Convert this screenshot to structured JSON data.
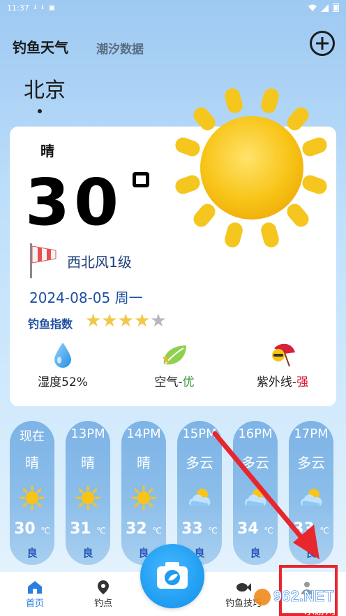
{
  "status_bar": {
    "time": "11:37"
  },
  "header": {
    "app_title": "钓鱼天气",
    "tide_link": "潮汐数据",
    "add_icon": "plus-circle-icon"
  },
  "location": {
    "city": "北京"
  },
  "today": {
    "condition": "晴",
    "temperature": "30",
    "wind": "西北风1级",
    "date": "2024-08-05 周一",
    "fishing_index_label": "钓鱼指数",
    "fishing_index_stars": 4,
    "fishing_index_max": 5
  },
  "metrics": {
    "humidity_label": "湿度52%",
    "air_label": "空气-",
    "air_value": "优",
    "uv_label": "紫外线-",
    "uv_value": "强"
  },
  "hourly": [
    {
      "time": "现在",
      "condition": "晴",
      "temp": "30",
      "unit": "℃",
      "aq": "良",
      "icon": "sun-icon"
    },
    {
      "time": "13PM",
      "condition": "晴",
      "temp": "31",
      "unit": "℃",
      "aq": "良",
      "icon": "sun-icon"
    },
    {
      "time": "14PM",
      "condition": "晴",
      "temp": "32",
      "unit": "℃",
      "aq": "良",
      "icon": "sun-icon"
    },
    {
      "time": "15PM",
      "condition": "多云",
      "temp": "33",
      "unit": "℃",
      "aq": "良",
      "icon": "partly-cloudy-icon"
    },
    {
      "time": "16PM",
      "condition": "多云",
      "temp": "34",
      "unit": "℃",
      "aq": "良",
      "icon": "partly-cloudy-icon"
    },
    {
      "time": "17PM",
      "condition": "多云",
      "temp": "33",
      "unit": "℃",
      "aq": "良",
      "icon": "partly-cloudy-icon"
    }
  ],
  "bottom_nav": {
    "home": "首页",
    "spot": "钓点",
    "skill": "钓鱼技巧",
    "mine": ""
  },
  "watermark": {
    "text": "962.NET",
    "subtext": "乐游网"
  },
  "colors": {
    "accent": "#2a7fe0",
    "date_blue": "#1f4fa0",
    "hour_column": "#7db3e6",
    "star_on": "#f2c84b",
    "star_off": "#b5b8bc",
    "air_good": "#3a9a3a",
    "uv_strong": "#d8203a",
    "annotation_red": "#e8262e"
  }
}
